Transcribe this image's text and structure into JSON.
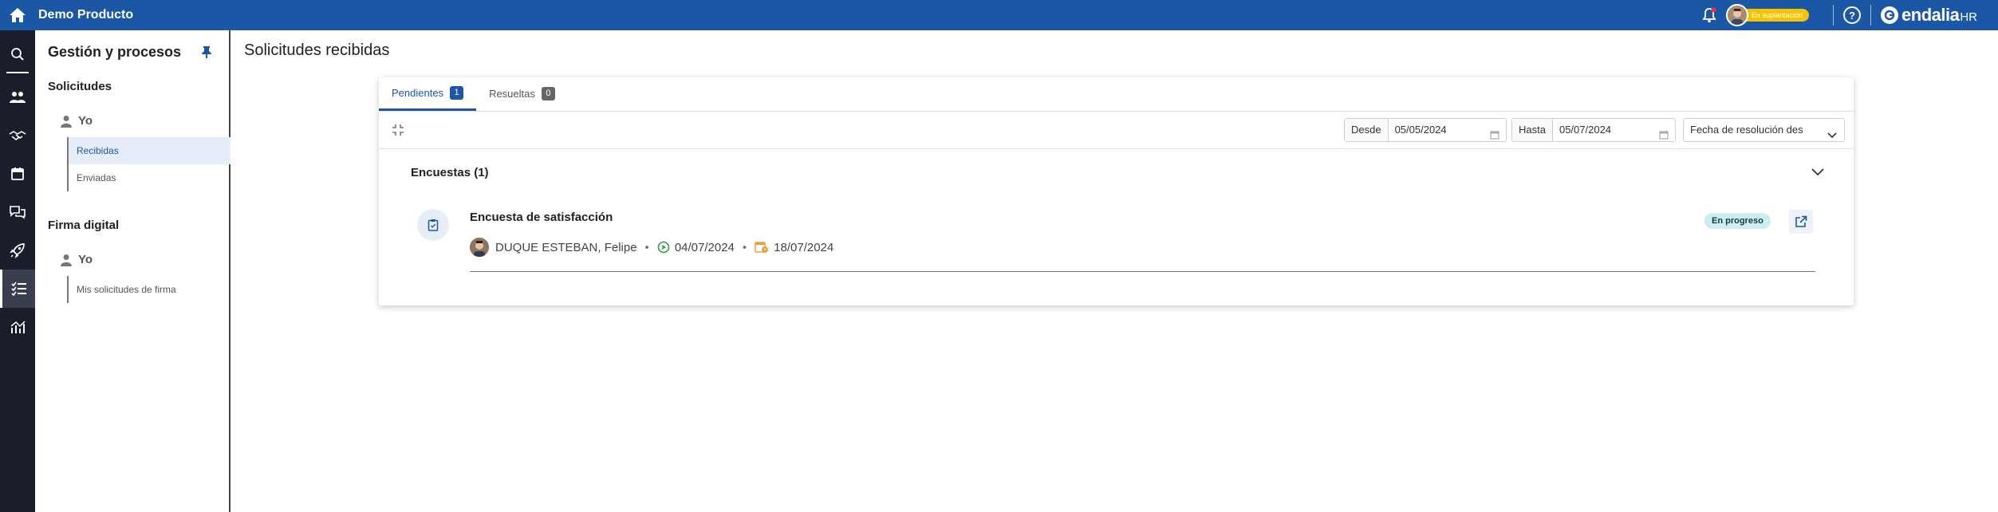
{
  "app": {
    "title": "Demo Producto",
    "brand": "endalia",
    "brand_suffix": "HR"
  },
  "header": {
    "impersonation_badge": "En suplantación",
    "help_label": "?"
  },
  "sidebar": {
    "title": "Gestión y procesos",
    "sections": [
      {
        "title": "Solicitudes",
        "user": "Yo",
        "items": [
          "Recibidas",
          "Enviadas"
        ]
      },
      {
        "title": "Firma digital",
        "user": "Yo",
        "items": [
          "Mis solicitudes de firma"
        ]
      }
    ]
  },
  "page": {
    "title": "Solicitudes recibidas"
  },
  "tabs": [
    {
      "label": "Pendientes",
      "count": "1"
    },
    {
      "label": "Resueltas",
      "count": "0"
    }
  ],
  "filters": {
    "from_label": "Desde",
    "from_value": "05/05/2024",
    "to_label": "Hasta",
    "to_value": "05/07/2024",
    "sort_value": "Fecha de resolución des"
  },
  "group": {
    "title": "Encuestas (1)"
  },
  "request": {
    "title": "Encuesta de satisfacción",
    "user": "DUQUE ESTEBAN, Felipe",
    "start_date": "04/07/2024",
    "due_date": "18/07/2024",
    "status": "En progreso"
  },
  "colors": {
    "brand": "#1c57a5",
    "rail": "#1a1e2b",
    "badge": "#f5c400",
    "status_bg": "#cdeef0"
  }
}
